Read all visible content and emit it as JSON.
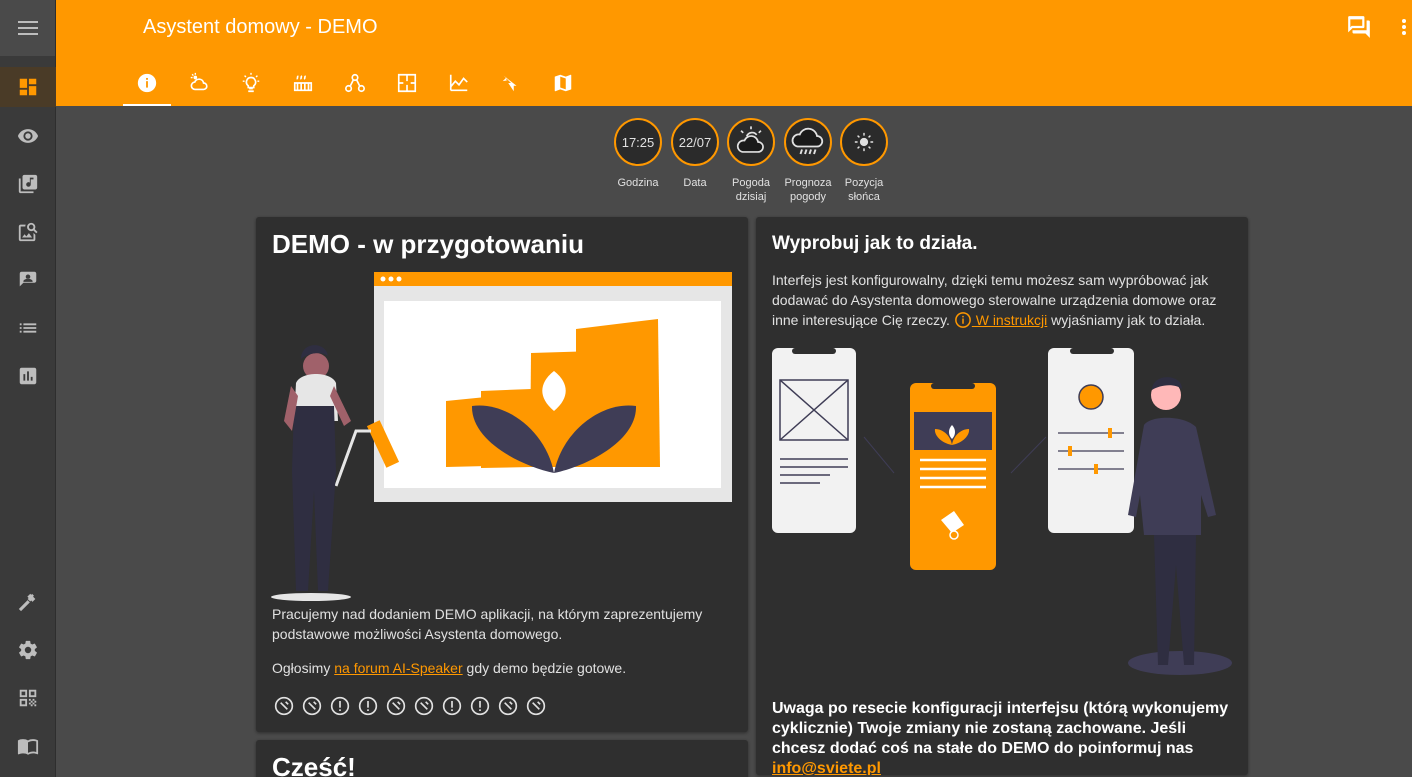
{
  "header": {
    "title": "Asystent domowy - DEMO"
  },
  "sidebar": {
    "items": [
      {
        "icon": "dashboard-icon"
      },
      {
        "icon": "eye-icon"
      },
      {
        "icon": "music-library-icon"
      },
      {
        "icon": "image-search-icon"
      },
      {
        "icon": "account-box-icon"
      },
      {
        "icon": "list-icon"
      },
      {
        "icon": "bar-chart-icon"
      },
      {
        "icon": "hammer-icon"
      },
      {
        "icon": "gear-icon"
      },
      {
        "icon": "qr-code-icon"
      },
      {
        "icon": "book-icon"
      }
    ]
  },
  "tabs": [
    {
      "icon": "info-icon"
    },
    {
      "icon": "weather-icon"
    },
    {
      "icon": "lightbulb-icon"
    },
    {
      "icon": "radiator-icon"
    },
    {
      "icon": "network-icon"
    },
    {
      "icon": "floorplan-icon"
    },
    {
      "icon": "chart-area-icon"
    },
    {
      "icon": "power-icon"
    },
    {
      "icon": "map-icon"
    }
  ],
  "badges": [
    {
      "value": "17:25",
      "label": "Godzina"
    },
    {
      "value": "22/07",
      "label": "Data"
    },
    {
      "value": "",
      "label": "Pogoda dzisiaj",
      "icon": "partly-cloudy-icon"
    },
    {
      "value": "",
      "label": "Prognoza pogody",
      "icon": "rainy-icon"
    },
    {
      "value": "",
      "label": "Pozycja słońca",
      "icon": "sun-icon"
    }
  ],
  "left_card": {
    "title": "DEMO - w przygotowaniu",
    "p1": "Pracujemy nad dodaniem DEMO aplikacji, na którym zaprezentujemy podstawowe możliwości Asystenta domowego.",
    "p2_before": "Ogłosimy ",
    "p2_link": "na forum AI-Speaker",
    "p2_after": " gdy demo będzie gotowe."
  },
  "right_card": {
    "title": "Wyprobuj jak to działa.",
    "p1": "Interfejs jest konfigurowalny, dzięki temu możesz sam wypróbować jak dodawać do Asystenta domowego sterowalne urządzenia domowe oraz inne interesujące Cię rzeczy. ",
    "p1_link": " W instrukcji",
    "p1_after": " wyjaśniamy jak to działa.",
    "warning": "Uwaga po resecie konfiguracji interfejsu (którą wykonujemy cyklicznie) Twoje zmiany nie zostaną zachowane. Jeśli chcesz dodać coś na stałe do DEMO do poinformuj nas ",
    "warning_link": "info@sviete.pl"
  },
  "bottom_card": {
    "title": "Cześć!"
  },
  "colors": {
    "accent": "#ff9800",
    "card": "#2f2f2f",
    "background": "#4a4a4a",
    "dark_figure": "#3f3d56"
  }
}
